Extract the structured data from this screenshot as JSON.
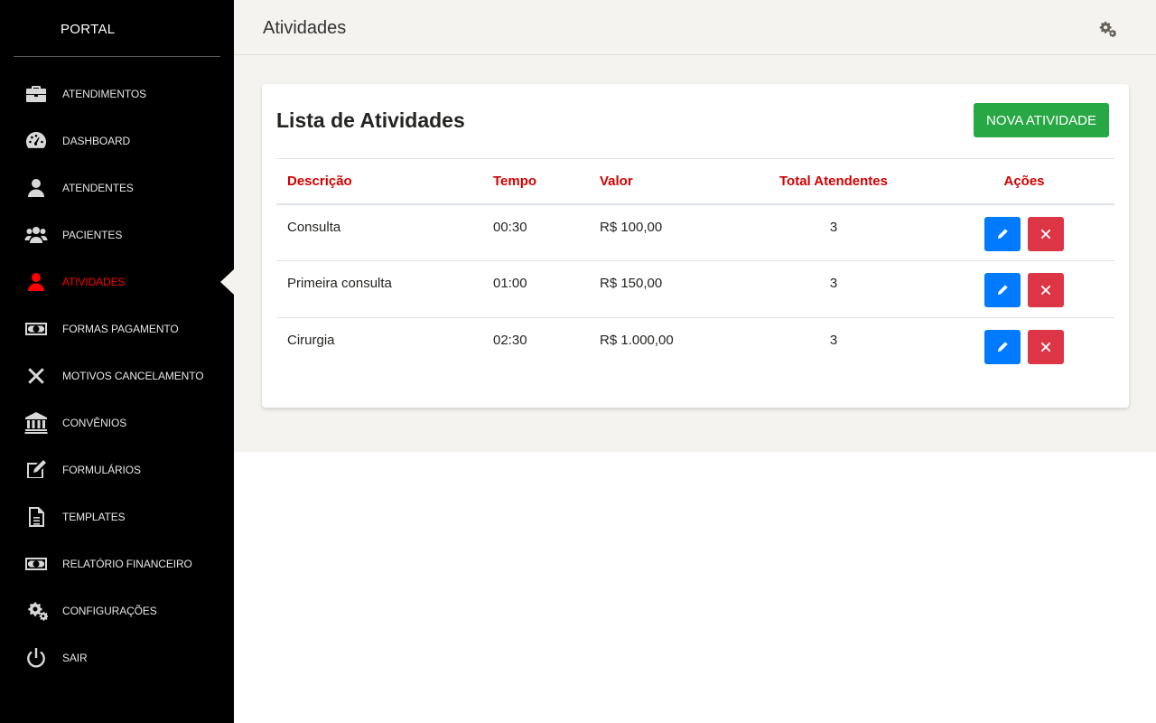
{
  "sidebar": {
    "brand": "PORTAL",
    "items": [
      {
        "label": "ATENDIMENTOS",
        "icon": "briefcase-icon"
      },
      {
        "label": "DASHBOARD",
        "icon": "dashboard-gauge-icon"
      },
      {
        "label": "ATENDENTES",
        "icon": "user-icon"
      },
      {
        "label": "PACIENTES",
        "icon": "users-icon"
      },
      {
        "label": "ATIVIDADES",
        "icon": "user-icon",
        "active": true
      },
      {
        "label": "FORMAS PAGAMENTO",
        "icon": "money-bill-icon"
      },
      {
        "label": "MOTIVOS CANCELAMENTO",
        "icon": "times-icon"
      },
      {
        "label": "CONVÊNIOS",
        "icon": "bank-icon"
      },
      {
        "label": "FORMULÁRIOS",
        "icon": "edit-icon"
      },
      {
        "label": "TEMPLATES",
        "icon": "file-text-icon"
      },
      {
        "label": "RELATÓRIO FINANCEIRO",
        "icon": "money-bill-icon"
      },
      {
        "label": "CONFIGURAÇÕES",
        "icon": "gears-icon"
      },
      {
        "label": "SAIR",
        "icon": "power-icon"
      }
    ],
    "active_color": "#ff0000"
  },
  "header": {
    "title": "Atividades",
    "settings_icon": "gears-icon"
  },
  "card": {
    "title": "Lista de Atividades",
    "new_button_label": "NOVA ATIVIDADE",
    "new_button_color": "#28a745"
  },
  "table": {
    "columns": [
      "Descrição",
      "Tempo",
      "Valor",
      "Total Atendentes",
      "Ações"
    ],
    "header_color": "#d40000",
    "rows": [
      {
        "descricao": "Consulta",
        "tempo": "00:30",
        "valor": "R$ 100,00",
        "total": "3"
      },
      {
        "descricao": "Primeira consulta",
        "tempo": "01:00",
        "valor": "R$ 150,00",
        "total": "3"
      },
      {
        "descricao": "Cirurgia",
        "tempo": "02:30",
        "valor": "R$ 1.000,00",
        "total": "3"
      }
    ],
    "edit_icon": "pencil-icon",
    "delete_icon": "times-icon",
    "edit_color": "#007bff",
    "delete_color": "#dc3545"
  }
}
